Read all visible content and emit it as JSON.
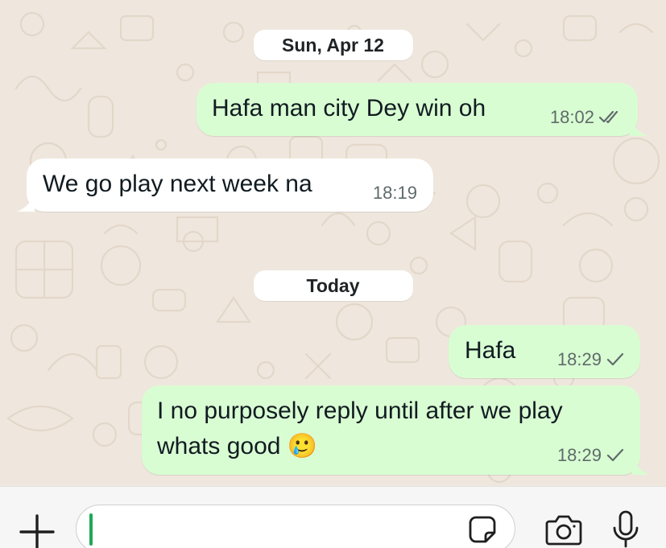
{
  "chat": {
    "date_pills": [
      "Sun, Apr 12",
      "Today"
    ],
    "messages": [
      {
        "direction": "outgoing",
        "text": "Hafa man city Dey win oh",
        "time": "18:02",
        "status": "read"
      },
      {
        "direction": "incoming",
        "text": "We go play next week na",
        "time": "18:19"
      },
      {
        "direction": "outgoing",
        "text": "Hafa",
        "time": "18:29",
        "status": "sent"
      },
      {
        "direction": "outgoing",
        "line1": "I no purposely reply until after we play",
        "line2": "whats good",
        "emoji": "🥲",
        "time": "18:29",
        "status": "sent"
      }
    ]
  },
  "composer": {
    "input_value": "",
    "icons": [
      "plus-icon",
      "sticker-icon",
      "camera-icon",
      "microphone-icon"
    ]
  },
  "colors": {
    "outgoing_bubble": "#d9fdd3",
    "incoming_bubble": "#ffffff",
    "wallpaper": "#efe7dd",
    "caret": "#1fa855"
  }
}
